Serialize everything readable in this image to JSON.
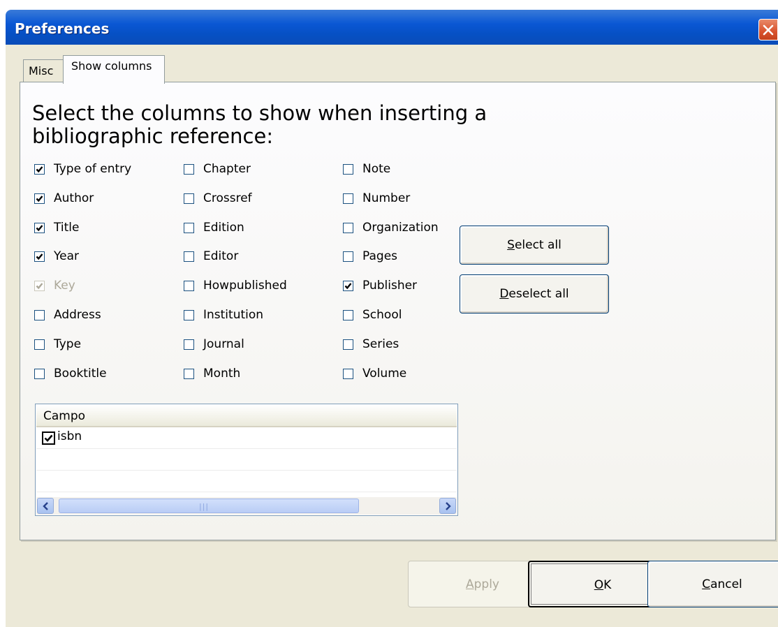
{
  "window": {
    "title": "Preferences",
    "close_icon": "close-icon"
  },
  "tabs": [
    {
      "label": "Misc",
      "selected": false
    },
    {
      "label": "Show columns",
      "selected": true
    }
  ],
  "heading": "Select the columns to show when inserting a bibliographic reference:",
  "columns": {
    "col1": [
      {
        "label": "Type of entry",
        "checked": true,
        "disabled": false
      },
      {
        "label": "Author",
        "checked": true,
        "disabled": false
      },
      {
        "label": "Title",
        "checked": true,
        "disabled": false
      },
      {
        "label": "Year",
        "checked": true,
        "disabled": false
      },
      {
        "label": "Key",
        "checked": true,
        "disabled": true
      },
      {
        "label": "Address",
        "checked": false,
        "disabled": false
      },
      {
        "label": "Type",
        "checked": false,
        "disabled": false
      },
      {
        "label": "Booktitle",
        "checked": false,
        "disabled": false
      }
    ],
    "col2": [
      {
        "label": "Chapter",
        "checked": false,
        "disabled": false
      },
      {
        "label": "Crossref",
        "checked": false,
        "disabled": false
      },
      {
        "label": "Edition",
        "checked": false,
        "disabled": false
      },
      {
        "label": "Editor",
        "checked": false,
        "disabled": false
      },
      {
        "label": "Howpublished",
        "checked": false,
        "disabled": false
      },
      {
        "label": "Institution",
        "checked": false,
        "disabled": false
      },
      {
        "label": "Journal",
        "checked": false,
        "disabled": false
      },
      {
        "label": "Month",
        "checked": false,
        "disabled": false
      }
    ],
    "col3": [
      {
        "label": "Note",
        "checked": false,
        "disabled": false
      },
      {
        "label": "Number",
        "checked": false,
        "disabled": false
      },
      {
        "label": "Organization",
        "checked": false,
        "disabled": false
      },
      {
        "label": "Pages",
        "checked": false,
        "disabled": false
      },
      {
        "label": "Publisher",
        "checked": true,
        "disabled": false
      },
      {
        "label": "School",
        "checked": false,
        "disabled": false
      },
      {
        "label": "Series",
        "checked": false,
        "disabled": false
      },
      {
        "label": "Volume",
        "checked": false,
        "disabled": false
      }
    ]
  },
  "side_buttons": {
    "select_all": "Select all",
    "deselect_all": "Deselect all"
  },
  "custom_fields": {
    "header": "Campo",
    "rows": [
      {
        "label": "isbn",
        "checked": true
      }
    ]
  },
  "footer": {
    "apply": "Apply",
    "ok": "OK",
    "cancel": "Cancel",
    "apply_enabled": false
  }
}
